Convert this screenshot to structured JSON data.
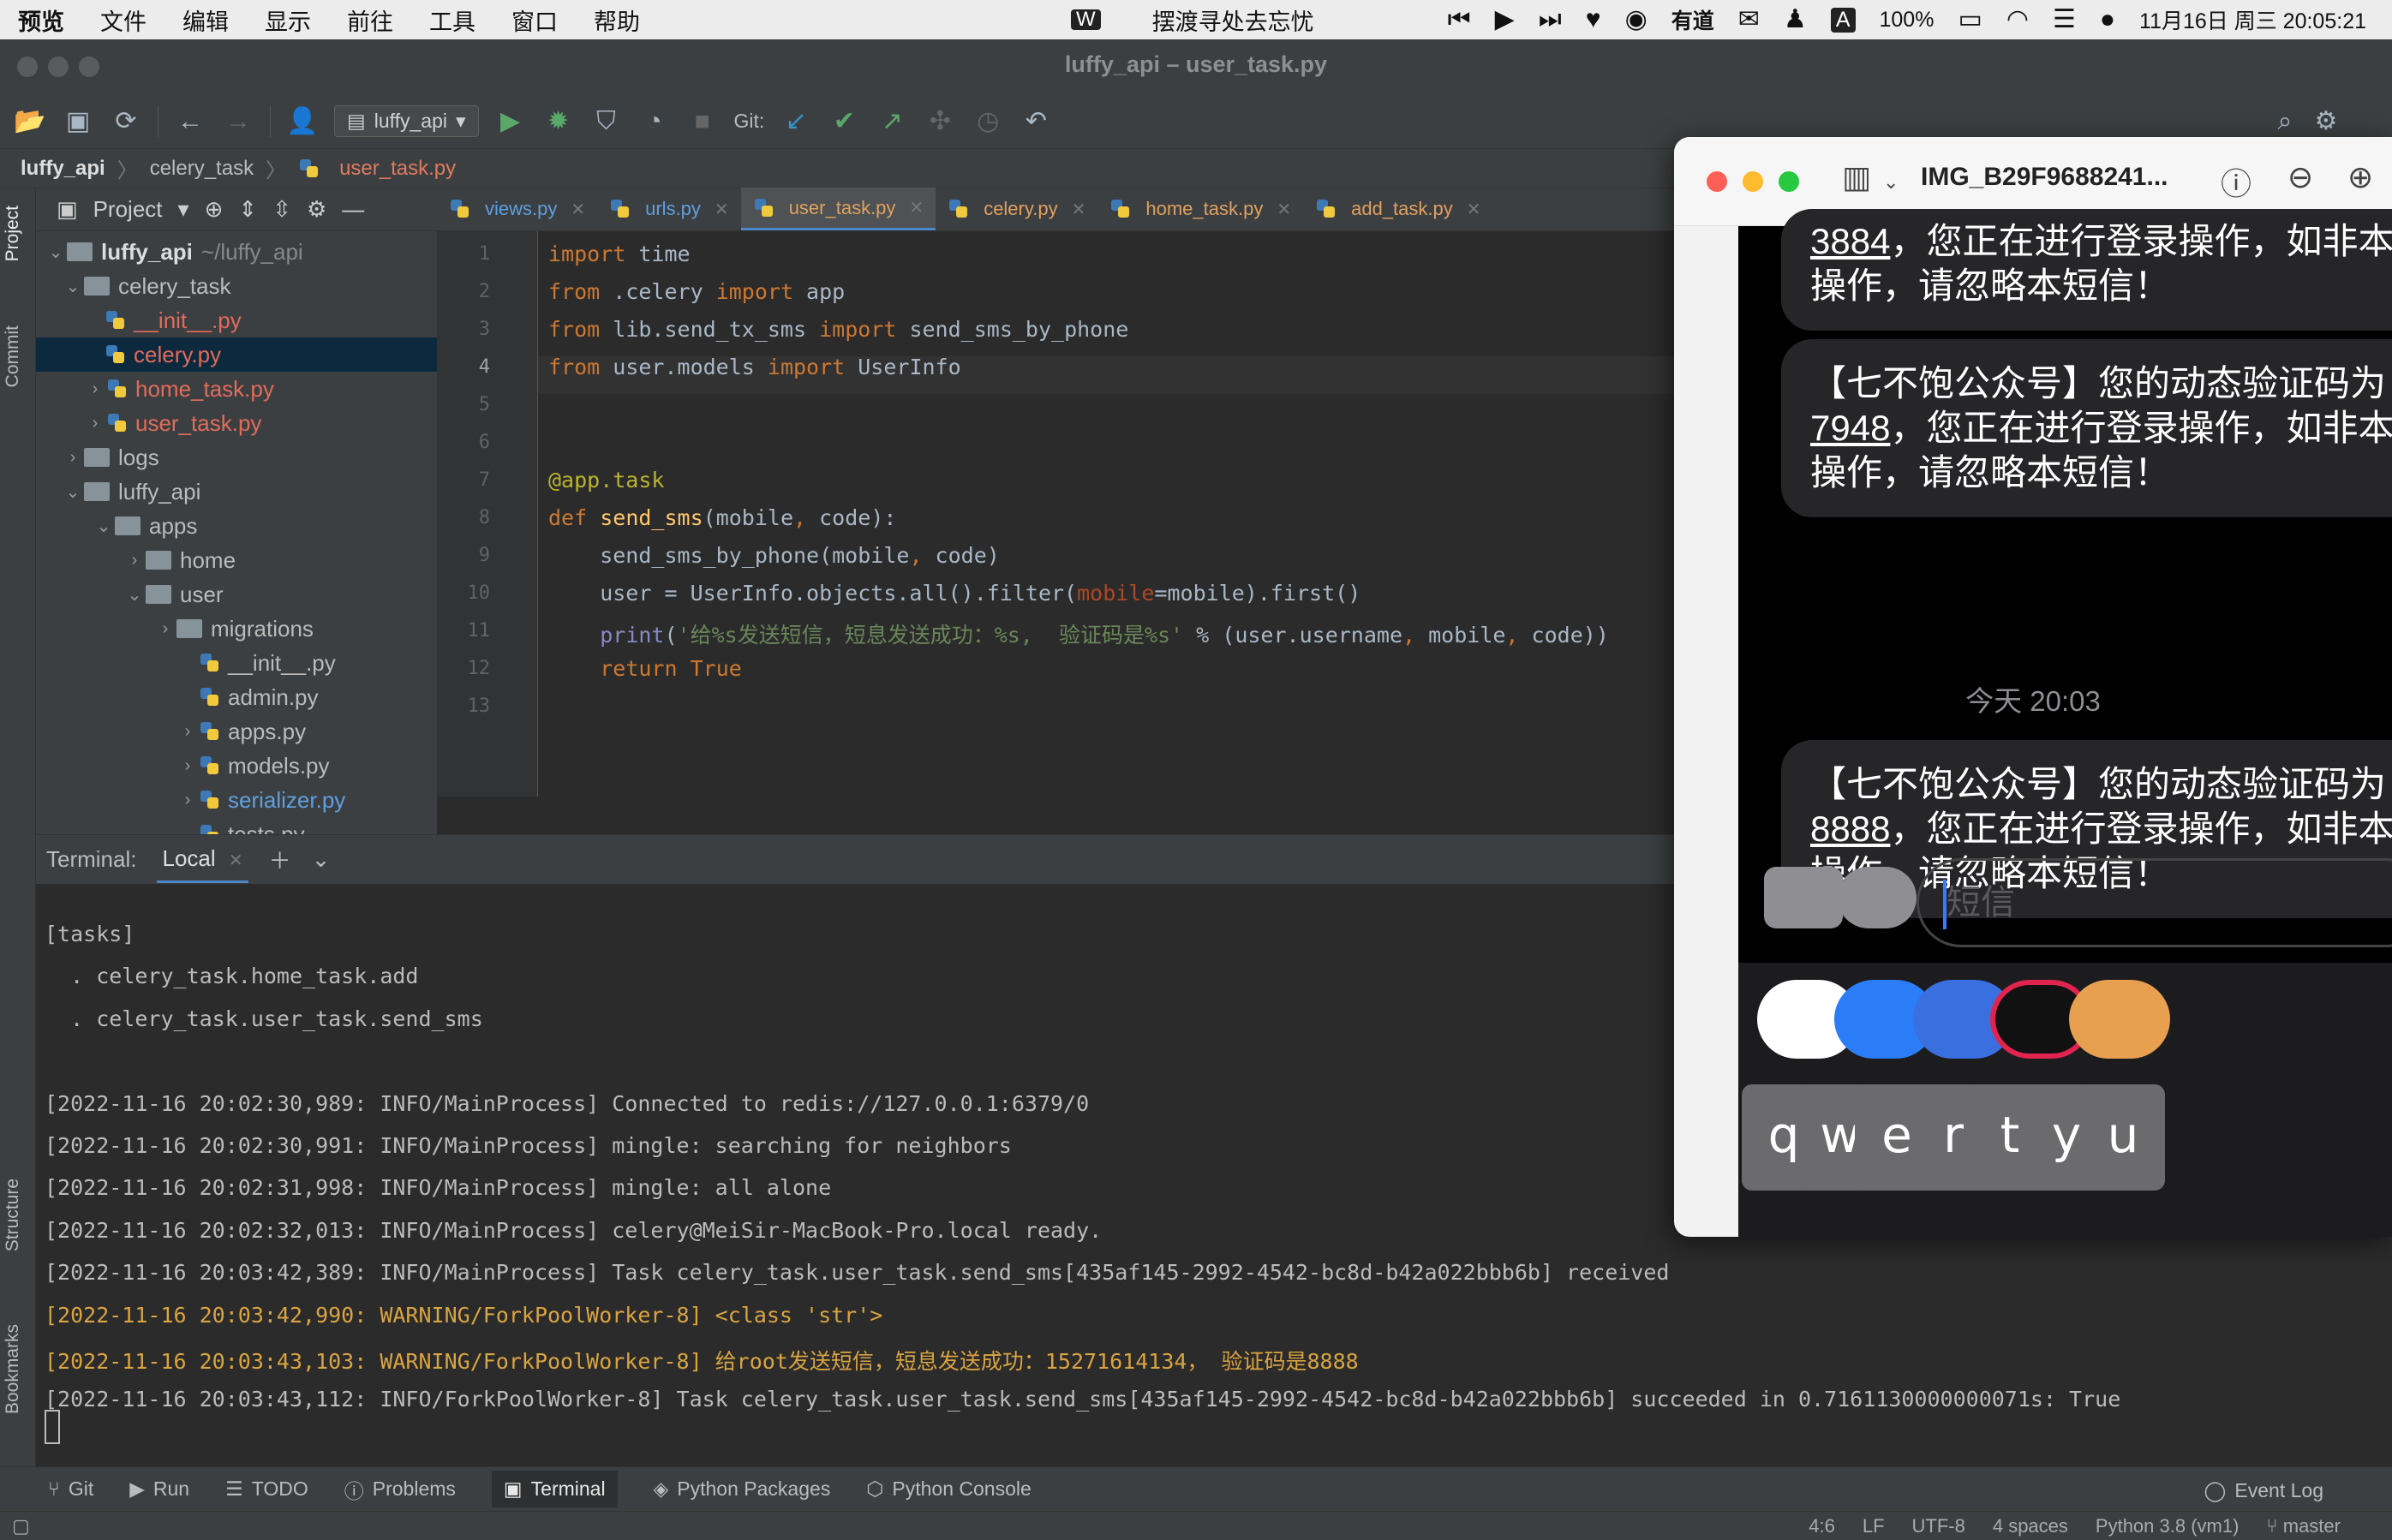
{
  "menubar": {
    "items": [
      "预览",
      "文件",
      "编辑",
      "显示",
      "前往",
      "工具",
      "窗口",
      "帮助"
    ],
    "now_playing": "摆渡寻处去忘忧",
    "battery": "100%",
    "datetime": "11月16日 周三 20:05:21",
    "youdao": "有道",
    "input_method": "A"
  },
  "ide": {
    "title": "luffy_api – user_task.py",
    "run_config": "luffy_api",
    "git_label": "Git:"
  },
  "breadcrumb": {
    "items": [
      "luffy_api",
      "celery_task",
      "user_task.py"
    ]
  },
  "left_stripe": {
    "project": "Project",
    "commit": "Commit",
    "structure": "Structure",
    "bookmarks": "Bookmarks"
  },
  "project": {
    "header": "Project",
    "root_name": "luffy_api",
    "root_path": "~/luffy_api",
    "tree": [
      {
        "label": "celery_task"
      },
      {
        "label": "__init__.py"
      },
      {
        "label": "celery.py"
      },
      {
        "label": "home_task.py"
      },
      {
        "label": "user_task.py"
      },
      {
        "label": "logs"
      },
      {
        "label": "luffy_api"
      },
      {
        "label": "apps"
      },
      {
        "label": "home"
      },
      {
        "label": "user"
      },
      {
        "label": "migrations"
      },
      {
        "label": "__init__.py"
      },
      {
        "label": "admin.py"
      },
      {
        "label": "apps.py"
      },
      {
        "label": "models.py"
      },
      {
        "label": "serializer.py"
      },
      {
        "label": "tests.py"
      }
    ]
  },
  "editor": {
    "tabs": [
      "views.py",
      "urls.py",
      "user_task.py",
      "celery.py",
      "home_task.py",
      "add_task.py"
    ],
    "active_tab": "user_task.py",
    "line_numbers": [
      "1",
      "2",
      "3",
      "4",
      "5",
      "6",
      "7",
      "8",
      "9",
      "10",
      "11",
      "12",
      "13"
    ]
  },
  "terminal": {
    "label": "Terminal:",
    "tab": "Local",
    "lines": [
      "[tasks]",
      "  . celery_task.home_task.add",
      "  . celery_task.user_task.send_sms",
      "",
      "[2022-11-16 20:02:30,989: INFO/MainProcess] Connected to redis://127.0.0.1:6379/0",
      "[2022-11-16 20:02:30,991: INFO/MainProcess] mingle: searching for neighbors",
      "[2022-11-16 20:02:31,998: INFO/MainProcess] mingle: all alone",
      "[2022-11-16 20:02:32,013: INFO/MainProcess] celery@MeiSir-MacBook-Pro.local ready.",
      "[2022-11-16 20:03:42,389: INFO/MainProcess] Task celery_task.user_task.send_sms[435af145-2992-4542-bc8d-b42a022bbb6b] received",
      "[2022-11-16 20:03:42,990: WARNING/ForkPoolWorker-8] <class 'str'>",
      "[2022-11-16 20:03:43,103: WARNING/ForkPoolWorker-8] 给root发送短信，短息发送成功：15271614134， 验证码是8888",
      "[2022-11-16 20:03:43,112: INFO/ForkPoolWorker-8] Task celery_task.user_task.send_sms[435af145-2992-4542-bc8d-b42a022bbb6b] succeeded in 0.7161130000000071s: True"
    ]
  },
  "bottom_tools": [
    "Git",
    "Run",
    "TODO",
    "Problems",
    "Terminal",
    "Python Packages",
    "Python Console"
  ],
  "event_log": "Event Log",
  "status": {
    "position": "4:6",
    "line_sep": "LF",
    "encoding": "UTF-8",
    "indent": "4 spaces",
    "interpreter": "Python 3.8 (vm1)",
    "branch": "master"
  },
  "phone": {
    "title": "IMG_B29F9688241...",
    "messages": [
      {
        "code": "3884",
        "rest_line1": "，您正在进行登录操作，如非本",
        "line2": "操作，请忽略本短信！"
      },
      {
        "line1": "【七不饱公众号】您的动态验证码为",
        "code": "7948",
        "rest_line1": "，您正在进行登录操作，如非本",
        "line2": "操作，请忽略本短信！"
      },
      {
        "line1": "【七不饱公众号】您的动态验证码为",
        "code": "8888",
        "rest_line1": "，您正在进行登录操作，如非本",
        "line2": "操作，请忽略本短信！"
      }
    ],
    "timestamp": "今天 20:03",
    "sms_placeholder": "短信",
    "keys": [
      "q",
      "w",
      "e",
      "r",
      "t",
      "y",
      "u"
    ]
  }
}
